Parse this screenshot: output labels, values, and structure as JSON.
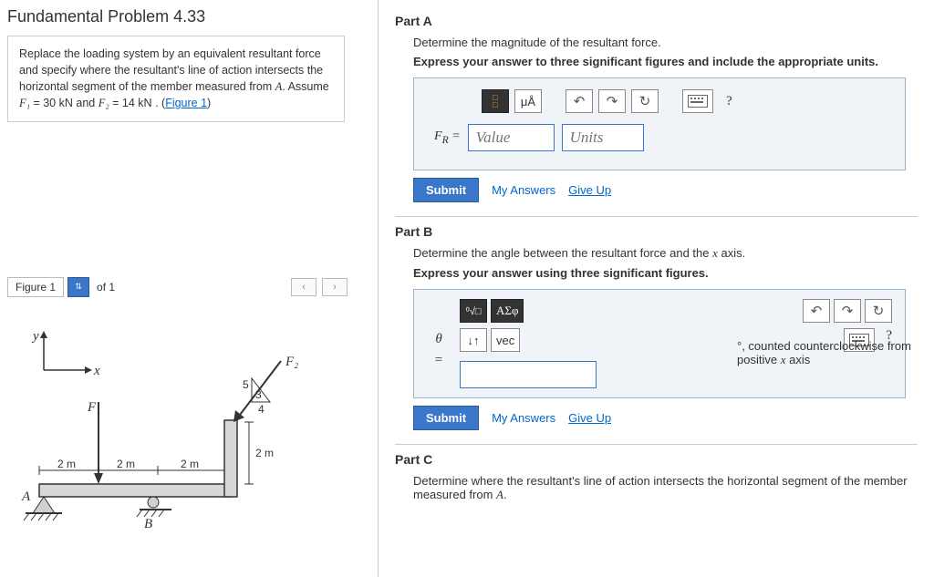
{
  "problem": {
    "title": "Fundamental Problem 4.33",
    "description_parts": {
      "t1": "Replace the loading system by an equivalent resultant force and specify where the resultant's line of action intersects the horizontal segment of the member measured from ",
      "A": "A",
      "t2": ". Assume ",
      "F1": "F₁",
      "eq1": " = 30 kN",
      "and": " and ",
      "F2": "F₂",
      "eq2": " = 14 kN",
      "t3": " . (",
      "figlink": "Figure 1",
      "t4": ")"
    }
  },
  "figure_nav": {
    "label": "Figure 1",
    "of_label": "of 1",
    "prev": "‹",
    "next": "›"
  },
  "figure": {
    "y": "y",
    "x": "x",
    "F1": "F₁",
    "F2": "F₂",
    "A": "A",
    "B": "B",
    "d1": "2 m",
    "d2": "2 m",
    "d3": "2 m",
    "dv": "2 m",
    "s3": "3",
    "s4": "4",
    "s5": "5"
  },
  "partA": {
    "header": "Part A",
    "instr1": "Determine the magnitude of the resultant force.",
    "instr2": "Express your answer to three significant figures and include the appropriate units.",
    "muA": "μÅ",
    "help": "?",
    "lhs": "F",
    "sub": "R",
    "eq": " = ",
    "value_ph": "Value",
    "units_ph": "Units",
    "submit": "Submit",
    "my_answers": "My Answers",
    "give_up": "Give Up"
  },
  "partB": {
    "header": "Part B",
    "instr1": "Determine the angle between the resultant force and the x axis.",
    "instr1_prefix": "Determine the angle between the resultant force and the ",
    "instr1_var": "x",
    "instr1_suffix": " axis.",
    "instr2": "Express your answer using three significant figures.",
    "greek": "ΑΣφ",
    "vec": "vec",
    "updown": "↓↑",
    "help": "?",
    "theta": "θ",
    "eq": "=",
    "note_deg": "°",
    "note_rest": ", counted counterclockwise from positive ",
    "note_var": "x",
    "note_suffix": " axis",
    "submit": "Submit",
    "my_answers": "My Answers",
    "give_up": "Give Up"
  },
  "partC": {
    "header": "Part C",
    "instr_prefix": "Determine where the resultant's line of action intersects the horizontal segment of the member measured from ",
    "instr_var": "A",
    "instr_suffix": "."
  }
}
